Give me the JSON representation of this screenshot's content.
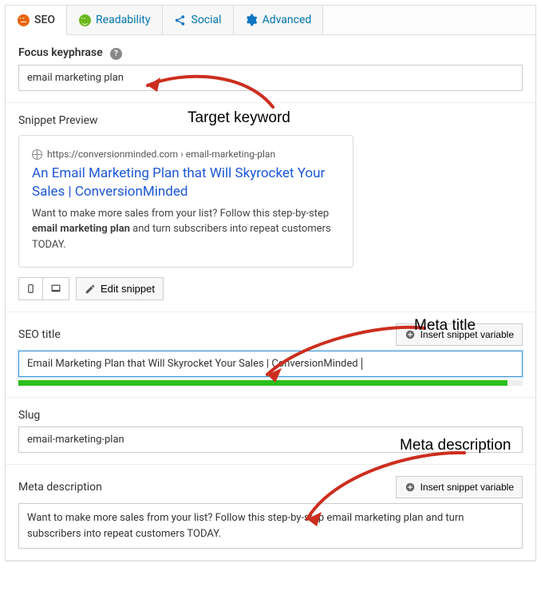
{
  "tabs": {
    "seo": "SEO",
    "readability": "Readability",
    "social": "Social",
    "advanced": "Advanced"
  },
  "focus": {
    "label": "Focus keyphrase",
    "value": "email marketing plan"
  },
  "snippet": {
    "heading": "Snippet Preview",
    "url": "https://conversionminded.com › email-marketing-plan",
    "title": "An Email Marketing Plan that Will Skyrocket Your Sales | ConversionMinded",
    "desc_pre": "Want to make more sales from your list? Follow this step-by-step ",
    "desc_bold": "email marketing plan",
    "desc_post": " and turn subscribers into repeat customers TODAY.",
    "edit_button": "Edit snippet"
  },
  "seo_title": {
    "label": "SEO title",
    "insert_btn": "Insert snippet variable",
    "value": "Email Marketing Plan that Will Skyrocket Your Sales | ConversionMinded"
  },
  "slug": {
    "label": "Slug",
    "value": "email-marketing-plan"
  },
  "meta_desc": {
    "label": "Meta description",
    "insert_btn": "Insert snippet variable",
    "value": "Want to make more sales from your list? Follow this step-by-step email marketing plan and turn subscribers into repeat customers TODAY."
  },
  "annotations": {
    "target_keyword": "Target keyword",
    "meta_title": "Meta title",
    "meta_description": "Meta description"
  }
}
